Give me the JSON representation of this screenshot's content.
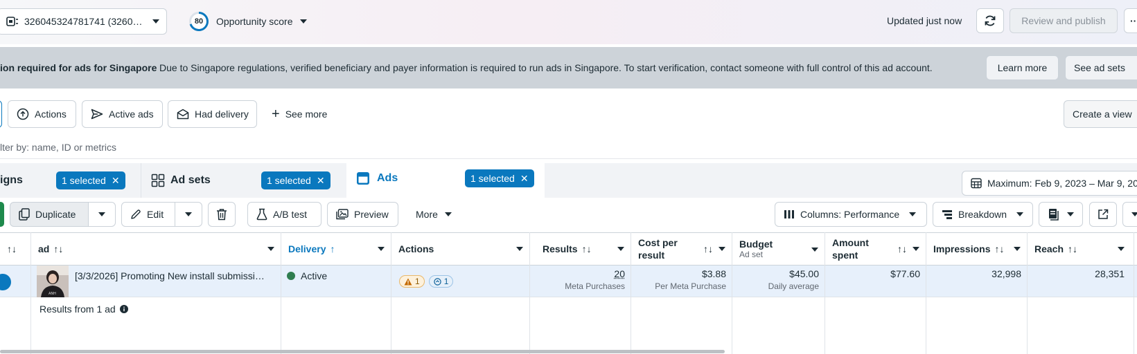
{
  "topbar": {
    "account_label": "326045324781741 (3260…",
    "score_value": "80",
    "score_label": "Opportunity score",
    "updated_text": "Updated just now",
    "review_publish": "Review and publish"
  },
  "banner": {
    "title": "ion required for ads for Singapore",
    "message": "Due to Singapore regulations, verified beneficiary and payer information is required to run ads in Singapore. To start verification, contact someone with full control of this ad account.",
    "learn_more": "Learn more",
    "see_ad_sets": "See ad sets"
  },
  "filters": {
    "actions": "Actions",
    "active_ads": "Active ads",
    "had_delivery": "Had delivery",
    "see_more": "See more",
    "create_view": "Create a view"
  },
  "search": {
    "placeholder": "lter by: name, ID or metrics"
  },
  "tabs": {
    "campaigns": "igns",
    "campaigns_badge": "1 selected",
    "adsets": "Ad sets",
    "adsets_badge": "1 selected",
    "ads": "Ads",
    "ads_badge": "1 selected",
    "date_range": "Maximum: Feb 9, 2023 – Mar 9, 20"
  },
  "toolbar": {
    "duplicate": "Duplicate",
    "edit": "Edit",
    "ab_test": "A/B test",
    "preview": "Preview",
    "more": "More",
    "columns": "Columns: Performance",
    "breakdown": "Breakdown"
  },
  "table": {
    "headers": {
      "ad": "ad",
      "delivery": "Delivery",
      "actions": "Actions",
      "results": "Results",
      "cost_per_result": "Cost per result",
      "budget": "Budget",
      "budget_sub": "Ad set",
      "amount_spent": "Amount spent",
      "impressions": "Impressions",
      "reach": "Reach"
    },
    "row": {
      "ad_name": "[3/3/2026] Promoting New install submissi…",
      "delivery": "Active",
      "warn_count": "1",
      "info_count": "1",
      "results": "20",
      "results_sub": "Meta Purchases",
      "cost": "$3.88",
      "cost_sub": "Per Meta Purchase",
      "budget": "$45.00",
      "budget_sub": "Daily average",
      "spent": "$77.60",
      "impressions": "32,998",
      "reach": "28,351"
    },
    "summary": "Results from 1 ad"
  },
  "colors": {
    "accent": "#0a78be",
    "banner_bg": "#cdd3d9",
    "active_green": "#2f7d4f",
    "selected_row": "#e7f0fb"
  }
}
